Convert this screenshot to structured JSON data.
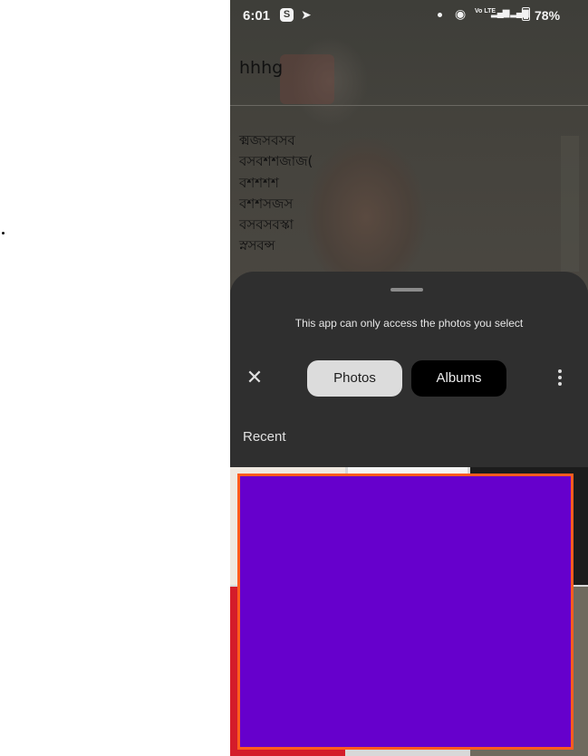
{
  "status_bar": {
    "time": "6:01",
    "skype_icon_glyph": "S",
    "telegram_icon_glyph": "➤",
    "wifi_icon_glyph": "◉",
    "volte_text": "Vo LTE",
    "signal_icon_glyph": "▂▄▆ ▂▄▆",
    "battery": "78%"
  },
  "app": {
    "title": "hhhg",
    "body_lines": [
      "ক্মজসবসব",
      "বসবশশজাজ(",
      "বশশশশ",
      "বশশসজস",
      "বসবসবস্কা",
      "স্নসবন্স"
    ]
  },
  "picker": {
    "notice": "This app can only access the photos you select",
    "close_icon_glyph": "✕",
    "tabs": [
      {
        "label": "Photos",
        "selected": true
      },
      {
        "label": "Albums",
        "selected": false
      }
    ],
    "section_label": "Recent"
  },
  "colors": {
    "sheet_bg": "#2f2f2f",
    "selected_tab": "#dcdcdc",
    "unselected_tab": "#000000",
    "overlay_fill": "#6600cc",
    "overlay_border": "#ff5c1f"
  }
}
